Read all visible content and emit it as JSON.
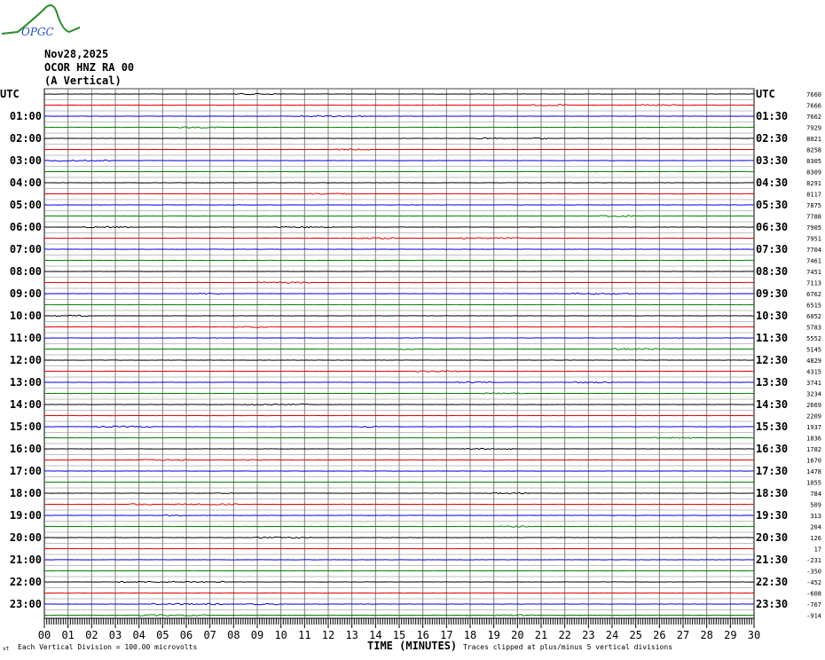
{
  "logo_text": "OPGC",
  "header": {
    "date": "Nov28,2025",
    "station": "OCOR HNZ RA 00",
    "component": "(A Vertical)"
  },
  "colors": {
    "trace_cycle": [
      "#000000",
      "#e00000",
      "#0000e0",
      "#008000"
    ],
    "grid": "#808080"
  },
  "chart_data": {
    "type": "line",
    "title": "Nov28,2025 OCOR HNZ RA 00 (A Vertical)",
    "xlabel": "TIME (MINUTES)",
    "xlim": [
      0,
      30
    ],
    "x_ticks": [
      "00",
      "01",
      "02",
      "03",
      "04",
      "05",
      "06",
      "07",
      "08",
      "09",
      "10",
      "11",
      "12",
      "13",
      "14",
      "15",
      "16",
      "17",
      "18",
      "19",
      "20",
      "21",
      "22",
      "23",
      "24",
      "25",
      "26",
      "27",
      "28",
      "29",
      "30"
    ],
    "left_labels": [
      "UTC",
      "01:00",
      "02:00",
      "03:00",
      "04:00",
      "05:00",
      "06:00",
      "07:00",
      "08:00",
      "09:00",
      "10:00",
      "11:00",
      "12:00",
      "13:00",
      "14:00",
      "15:00",
      "16:00",
      "17:00",
      "18:00",
      "19:00",
      "20:00",
      "21:00",
      "22:00",
      "23:00"
    ],
    "right_labels": [
      "UTC",
      "01:30",
      "02:30",
      "03:30",
      "04:30",
      "05:30",
      "06:30",
      "07:30",
      "08:30",
      "09:30",
      "10:30",
      "11:30",
      "12:30",
      "13:30",
      "14:30",
      "15:30",
      "16:30",
      "17:30",
      "18:30",
      "19:30",
      "20:30",
      "21:30",
      "22:30",
      "23:30"
    ],
    "trace_offsets": [
      "7660",
      "7666",
      "7662",
      "7929",
      "8021",
      "8258",
      "8305",
      "8309",
      "8291",
      "8117",
      "7875",
      "7788",
      "7905",
      "7951",
      "7704",
      "7461",
      "7451",
      "7113",
      "6762",
      "6515",
      "6052",
      "5783",
      "5552",
      "5145",
      "4829",
      "4315",
      "3741",
      "3234",
      "2669",
      "2209",
      "1937",
      "1836",
      "1782",
      "1670",
      "1478",
      "1055",
      "784",
      "509",
      "313",
      "204",
      "126",
      "17",
      "-231",
      "-350",
      "-452",
      "-608",
      "-767",
      "-914"
    ],
    "rows": 48
  },
  "footer": {
    "scale": "Each Vertical Division =  100.00 microvolts",
    "clip": "Traces clipped at plus/minus 5 vertical divisions",
    "corner": "vt"
  }
}
